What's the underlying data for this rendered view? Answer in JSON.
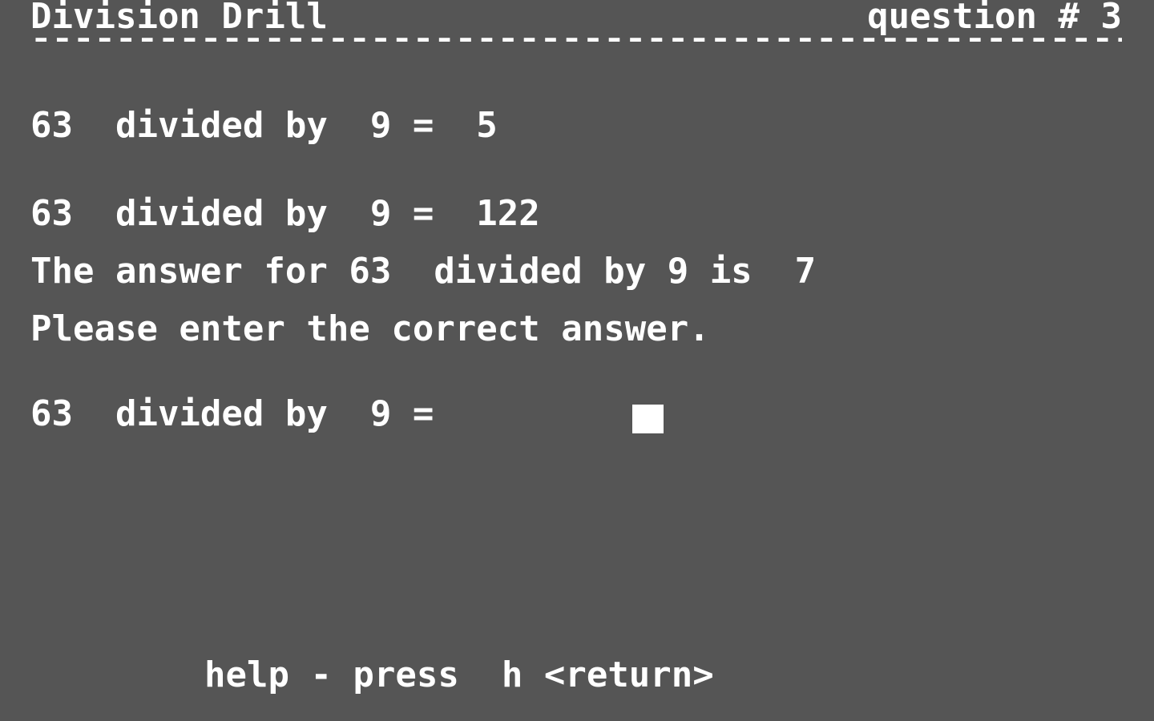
{
  "screen": {
    "background_color": "#555555",
    "text_color": "#ffffff",
    "program_title": "Division Drill",
    "question_counter": "question # 3",
    "header_rule": "------------------------------------",
    "help_line": "help - press  h <return>"
  },
  "history": [
    {
      "line_id": "attempt-1",
      "text": "63  divided by  9 =  5",
      "dividend": "63",
      "divisor": "9",
      "entered_answer": "5"
    },
    {
      "line_id": "attempt-2",
      "text": "63  divided by  9 =  122",
      "dividend": "63",
      "divisor": "9",
      "entered_answer": "122"
    }
  ],
  "feedback": {
    "answer_reveal": "The answer for 63  divided by 9 is  7",
    "correct_answer": "7",
    "instruction": "Please enter the correct answer."
  },
  "current_prompt": {
    "line_id": "attempt-3",
    "text": "63  divided by  9 =",
    "dividend": "63",
    "divisor": "9",
    "entered_answer": "",
    "cursor": "block-cursor"
  }
}
